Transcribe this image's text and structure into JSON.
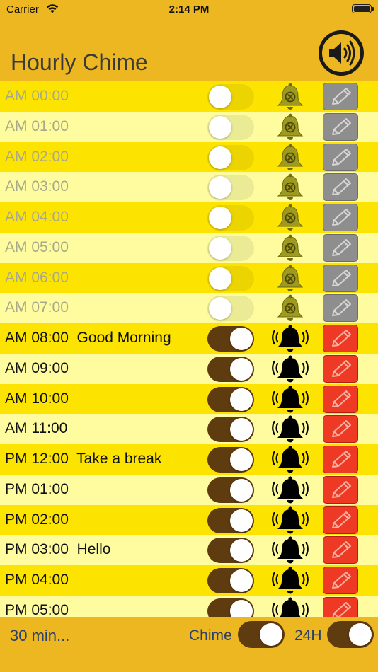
{
  "status_bar": {
    "carrier": "Carrier",
    "time": "2:14 PM"
  },
  "header": {
    "title": "Hourly Chime",
    "speaker_icon": "speaker-volume-icon"
  },
  "colors": {
    "accent": "#ecb720",
    "row_dark": "#fde400",
    "row_light": "#fefc9e",
    "toggle_on": "#5f3b10",
    "edit_on": "#ee3a24",
    "edit_off": "#8e8e8e"
  },
  "rows": [
    {
      "label": "AM 00:00",
      "enabled": false
    },
    {
      "label": "AM 01:00",
      "enabled": false
    },
    {
      "label": "AM 02:00",
      "enabled": false
    },
    {
      "label": "AM 03:00",
      "enabled": false
    },
    {
      "label": "AM 04:00",
      "enabled": false
    },
    {
      "label": "AM 05:00",
      "enabled": false
    },
    {
      "label": "AM 06:00",
      "enabled": false
    },
    {
      "label": "AM 07:00",
      "enabled": false
    },
    {
      "label": "AM 08:00  Good Morning",
      "enabled": true
    },
    {
      "label": "AM 09:00",
      "enabled": true
    },
    {
      "label": "AM 10:00",
      "enabled": true
    },
    {
      "label": "AM 11:00",
      "enabled": true
    },
    {
      "label": "PM 12:00  Take a break",
      "enabled": true
    },
    {
      "label": "PM 01:00",
      "enabled": true
    },
    {
      "label": "PM 02:00",
      "enabled": true
    },
    {
      "label": "PM 03:00  Hello",
      "enabled": true
    },
    {
      "label": "PM 04:00",
      "enabled": true
    },
    {
      "label": "PM 05:00",
      "enabled": true
    }
  ],
  "footer": {
    "interval": "30 min...",
    "chime_label": "Chime",
    "chime_on": true,
    "h24_label": "24H",
    "h24_on": true
  }
}
